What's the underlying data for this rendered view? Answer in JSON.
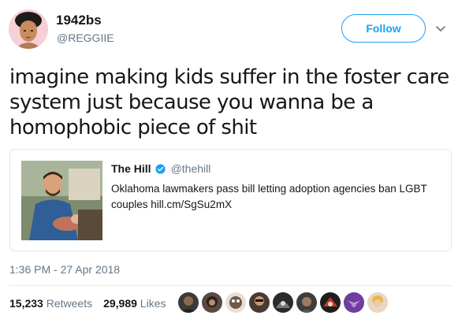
{
  "tweet": {
    "display_name": "1942bs",
    "handle": "@REGGIIE",
    "follow_label": "Follow",
    "text": "imagine making kids suffer in the foster care system just because you wanna be a homophobic piece of shit",
    "timestamp": "1:36 PM - 27 Apr 2018"
  },
  "quote": {
    "name": "The Hill",
    "handle": "@thehill",
    "text": "Oklahoma lawmakers pass bill letting adoption agencies ban LGBT couples hill.cm/SgSu2mX"
  },
  "stats": {
    "retweets_count": "15,233",
    "retweets_label": "Retweets",
    "likes_count": "29,989",
    "likes_label": "Likes"
  },
  "colors": {
    "accent": "#1da1f2",
    "muted": "#657786",
    "text": "#14171a",
    "border": "#e1e8ed"
  },
  "icons": {
    "caret": "chevron-down-icon",
    "verified": "verified-badge-icon"
  }
}
